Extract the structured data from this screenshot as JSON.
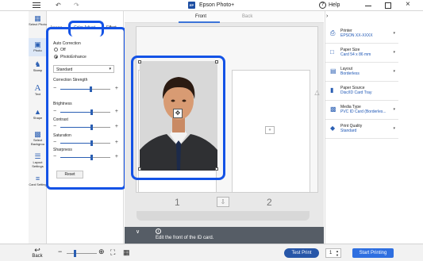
{
  "titlebar": {
    "app_logo_text": "EP",
    "title": "Epson Photo+",
    "help_label": "Help"
  },
  "left_tools": [
    {
      "icon": "select-photo-icon",
      "label": "Select Photo"
    },
    {
      "icon": "photo-icon",
      "label": "Photo"
    },
    {
      "icon": "stamp-icon",
      "label": "Stamp"
    },
    {
      "icon": "text-icon",
      "label": "Text"
    },
    {
      "icon": "shape-icon",
      "label": "Shape"
    },
    {
      "icon": "select-backgrounds-icon",
      "label": "Select Backgrou"
    },
    {
      "icon": "layout-settings-icon",
      "label": "Layout Settings"
    },
    {
      "icon": "card-settings-icon",
      "label": "Card Setting"
    }
  ],
  "panel": {
    "tabs": {
      "partial": "Arrang",
      "color_adjust": "Color Adjust",
      "effect": "Effect"
    },
    "auto_correction": {
      "title": "Auto Correction",
      "options": [
        "Off",
        "PhotoEnhance"
      ],
      "selected_index": 1
    },
    "mode_select": {
      "value": "Standard"
    },
    "sliders": [
      {
        "label": "Correction Strength",
        "level_fraction": 0.6
      },
      {
        "label": "Brightness",
        "level_fraction": 0.62
      },
      {
        "label": "Contrast",
        "level_fraction": 0.62
      },
      {
        "label": "Saturation",
        "level_fraction": 0.62
      },
      {
        "label": "Sharpness",
        "level_fraction": 0.62
      }
    ],
    "reset_label": "Reset"
  },
  "canvas": {
    "front_label": "Front",
    "back_label": "Back",
    "page_numbers": [
      "1",
      "2"
    ],
    "info_text": "Edit the front of the ID card."
  },
  "right_panel": [
    {
      "icon": "printer-icon",
      "label": "Printer",
      "value": "EPSON XX-XXXX"
    },
    {
      "icon": "paper-size-icon",
      "label": "Paper Size",
      "value": "Card 54 x 86 mm"
    },
    {
      "icon": "layout-icon",
      "label": "Layout",
      "value": "Borderless"
    },
    {
      "icon": "paper-source-icon",
      "label": "Paper Source",
      "value": "Disc/ID Card Tray"
    },
    {
      "icon": "media-type-icon",
      "label": "Media Type",
      "value": "PVC ID Card (Borderles..."
    },
    {
      "icon": "print-quality-icon",
      "label": "Print Quality",
      "value": "Standard"
    }
  ],
  "bottombar": {
    "back_label": "Back",
    "zoom_level_fraction": 0.25,
    "test_print_label": "Test Print",
    "copies_value": "1",
    "start_print_label": "Start Printing"
  },
  "colors": {
    "highlight": "#1453e6",
    "accent": "#2b5fb3",
    "start_button": "#2f6fe0"
  }
}
